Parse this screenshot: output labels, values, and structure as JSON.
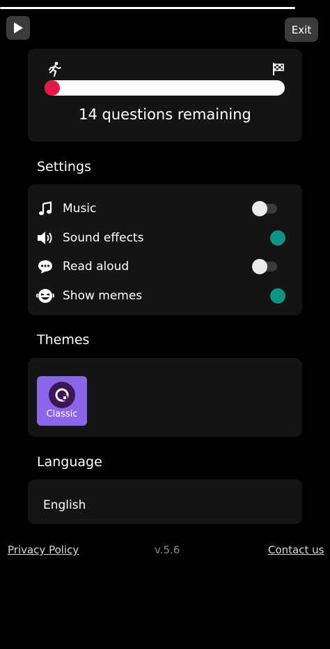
{
  "header": {
    "play_icon": "play-icon",
    "exit_label": "Exit"
  },
  "progress": {
    "runner_icon": "runner-icon",
    "finish_icon": "checkered-flag-icon",
    "fraction_complete": 0.05,
    "remaining_text": "14 questions remaining",
    "colors": {
      "fill": "#e8174b",
      "track": "#ffffff"
    }
  },
  "settings": {
    "title": "Settings",
    "items": [
      {
        "label": "Music",
        "icon": "music-note-icon",
        "enabled": false
      },
      {
        "label": "Sound effects",
        "icon": "speaker-icon",
        "enabled": true
      },
      {
        "label": "Read aloud",
        "icon": "speech-bubble-icon",
        "enabled": false
      },
      {
        "label": "Show memes",
        "icon": "laughing-face-icon",
        "enabled": true
      }
    ],
    "colors": {
      "on": "#0e9384",
      "off_knob": "#ececec"
    }
  },
  "themes": {
    "title": "Themes",
    "items": [
      {
        "label": "Classic",
        "icon": "quizizz-logo-icon",
        "color": "#8a67e8"
      }
    ]
  },
  "language": {
    "title": "Language",
    "value": "English"
  },
  "footer": {
    "privacy": "Privacy Policy",
    "version": "v.5.6",
    "contact": "Contact us"
  }
}
